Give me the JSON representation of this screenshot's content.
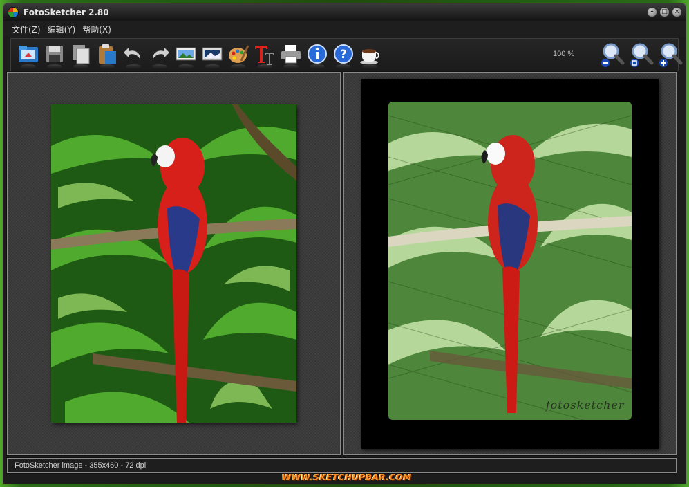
{
  "window": {
    "title": "FotoSketcher 2.80",
    "controls": [
      "minimize",
      "maximize",
      "close"
    ]
  },
  "menu": [
    {
      "label": "文件(Z)"
    },
    {
      "label": "编辑(Y)"
    },
    {
      "label": "帮助(X)"
    }
  ],
  "toolbar": {
    "buttons": [
      {
        "icon": "open-folder-icon"
      },
      {
        "icon": "save-disk-icon"
      },
      {
        "icon": "copy-icon"
      },
      {
        "icon": "paste-icon"
      },
      {
        "icon": "undo-icon"
      },
      {
        "icon": "redo-icon"
      },
      {
        "icon": "image-filmstrip-icon"
      },
      {
        "icon": "landscape-image-icon"
      },
      {
        "icon": "palette-icon"
      },
      {
        "icon": "text-tool-icon"
      },
      {
        "icon": "printer-icon"
      },
      {
        "icon": "info-icon"
      },
      {
        "icon": "help-icon"
      },
      {
        "icon": "coffee-cup-icon"
      }
    ],
    "zoom_level": "100 %",
    "zoom_buttons": [
      {
        "icon": "zoom-out-icon"
      },
      {
        "icon": "zoom-fit-icon"
      },
      {
        "icon": "zoom-in-icon"
      }
    ]
  },
  "panels": {
    "watermark": "fotosketcher"
  },
  "status": {
    "text": "FotoSketcher image - 355x460 - 72 dpi"
  },
  "banner": {
    "text": "WWW.SKETCHUPBAR.COM"
  },
  "colors": {
    "desktop_green": "#2f6e1a",
    "window_bg": "#1c1c1c",
    "parrot_red": "#d8201a",
    "foliage_green": "#3f9a24",
    "banner_orange": "#ff8a1e"
  }
}
